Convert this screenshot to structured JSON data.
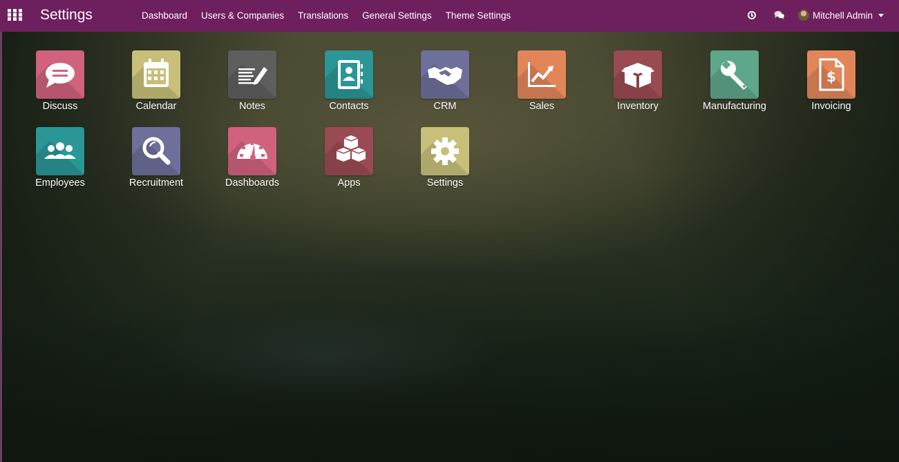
{
  "navbar": {
    "brand": "Settings",
    "menu": [
      "Dashboard",
      "Users & Companies",
      "Translations",
      "General Settings",
      "Theme Settings"
    ],
    "user_name": "Mitchell Admin",
    "icons": [
      "apps-grid-icon",
      "clock-icon",
      "chat-icon",
      "chevron-down-icon"
    ],
    "color": "#6e1f5e"
  },
  "apps": [
    {
      "label": "Discuss",
      "icon": "chat-bubble-icon",
      "color": "#d0627e"
    },
    {
      "label": "Calendar",
      "icon": "calendar-icon",
      "color": "#c8c07a"
    },
    {
      "label": "Notes",
      "icon": "notes-icon",
      "color": "#5e5e5e"
    },
    {
      "label": "Contacts",
      "icon": "address-book-icon",
      "color": "#2b9696"
    },
    {
      "label": "CRM",
      "icon": "handshake-icon",
      "color": "#6e6f9a"
    },
    {
      "label": "Sales",
      "icon": "chart-up-icon",
      "color": "#e2865a"
    },
    {
      "label": "Inventory",
      "icon": "box-icon",
      "color": "#9a4a52"
    },
    {
      "label": "Manufacturing",
      "icon": "wrench-icon",
      "color": "#5fa78a"
    },
    {
      "label": "Invoicing",
      "icon": "invoice-icon",
      "color": "#e2865a"
    },
    {
      "label": "Employees",
      "icon": "users-icon",
      "color": "#2b9696"
    },
    {
      "label": "Recruitment",
      "icon": "magnifier-icon",
      "color": "#6e6f9a"
    },
    {
      "label": "Dashboards",
      "icon": "gauge-icon",
      "color": "#d0627e"
    },
    {
      "label": "Apps",
      "icon": "cubes-icon",
      "color": "#9a4a52"
    },
    {
      "label": "Settings",
      "icon": "gear-icon",
      "color": "#c8c07a"
    }
  ]
}
